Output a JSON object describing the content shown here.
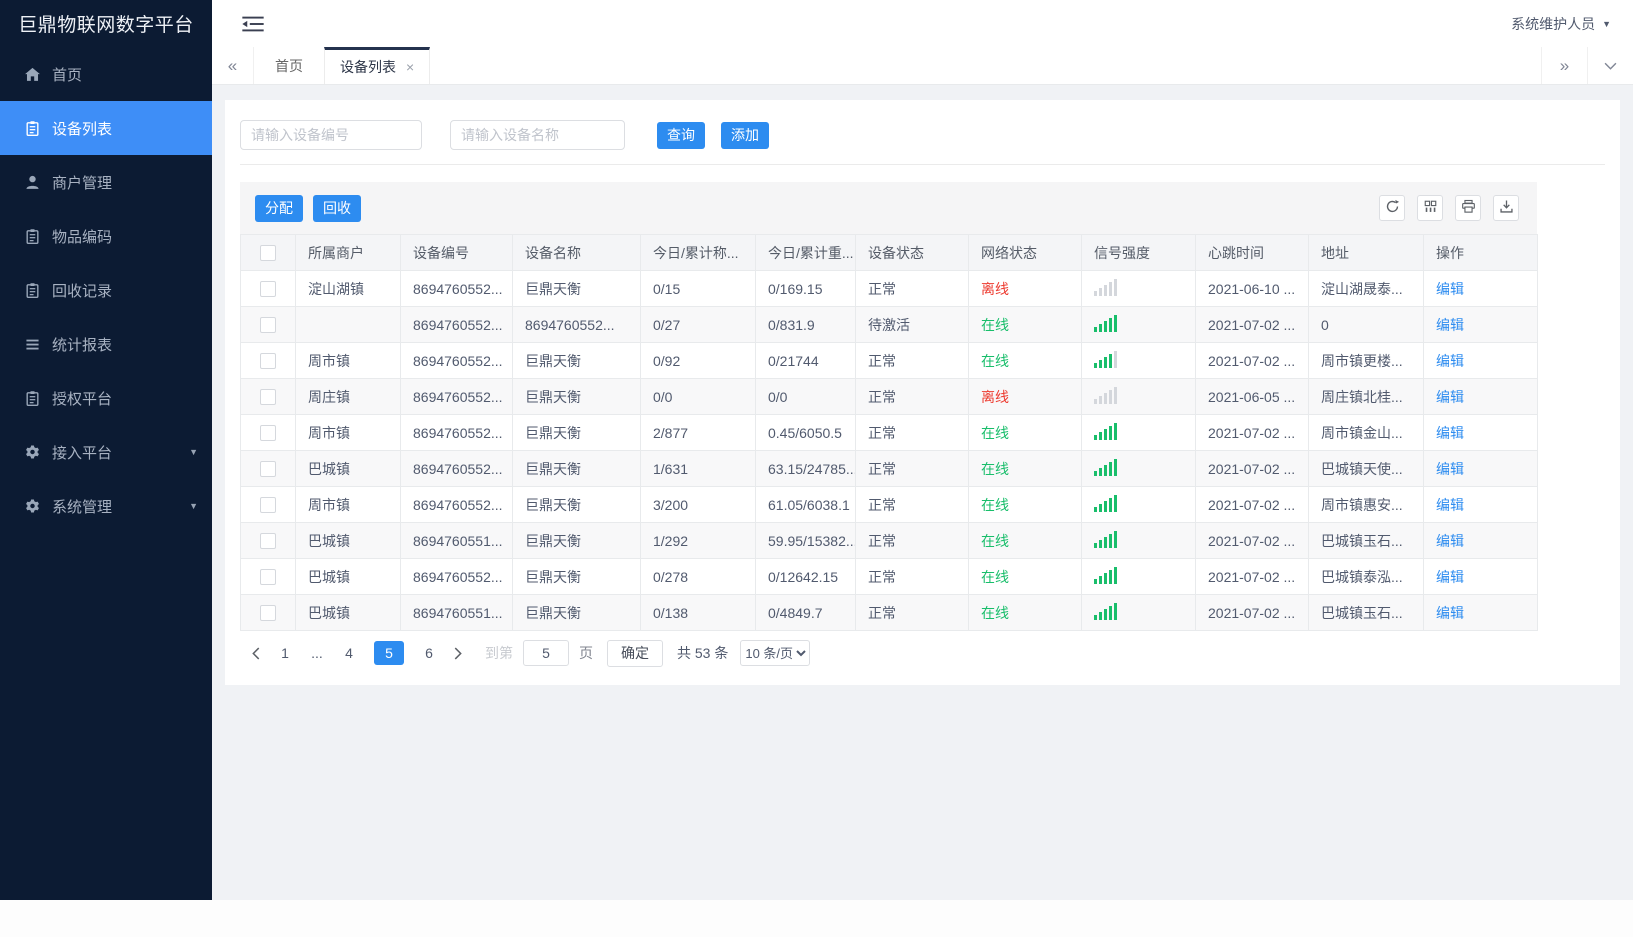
{
  "app": {
    "title": "巨鼎物联网数字平台"
  },
  "colors": {
    "primary": "#2d8cf0",
    "sidebar_bg": "#0c1b33",
    "sidebar_active": "#3e8ef7",
    "online_green": "#19be6b",
    "offline_red": "#ed3b30"
  },
  "sidebar": {
    "items": [
      {
        "key": "home",
        "label": "首页",
        "icon": "home-icon",
        "active": false,
        "expandable": false
      },
      {
        "key": "device-list",
        "label": "设备列表",
        "icon": "list-icon",
        "active": true,
        "expandable": false
      },
      {
        "key": "merchant-management",
        "label": "商户管理",
        "icon": "user-icon",
        "active": false,
        "expandable": false
      },
      {
        "key": "item-code",
        "label": "物品编码",
        "icon": "clipboard-icon",
        "active": false,
        "expandable": false
      },
      {
        "key": "recycle-records",
        "label": "回收记录",
        "icon": "clipboard-icon",
        "active": false,
        "expandable": false
      },
      {
        "key": "statistics-report",
        "label": "统计报表",
        "icon": "report-icon",
        "active": false,
        "expandable": false
      },
      {
        "key": "authorization-platform",
        "label": "授权平台",
        "icon": "clipboard-icon",
        "active": false,
        "expandable": false
      },
      {
        "key": "access-platform",
        "label": "接入平台",
        "icon": "gear-icon",
        "active": false,
        "expandable": true
      },
      {
        "key": "system-management",
        "label": "系统管理",
        "icon": "gear-icon",
        "active": false,
        "expandable": true
      }
    ]
  },
  "topbar": {
    "user_label": "系统维护人员"
  },
  "tabbar": {
    "tabs": [
      {
        "key": "home",
        "label": "首页",
        "active": false,
        "closable": false
      },
      {
        "key": "device-list",
        "label": "设备列表",
        "active": true,
        "closable": true
      }
    ]
  },
  "filters": {
    "device_no_placeholder": "请输入设备编号",
    "device_name_placeholder": "请输入设备名称",
    "search_label": "查询",
    "add_label": "添加"
  },
  "toolbar": {
    "assign_label": "分配",
    "recycle_label": "回收",
    "icons": [
      "refresh-icon",
      "columns-icon",
      "print-icon",
      "export-icon"
    ]
  },
  "table": {
    "columns": [
      "所属商户",
      "设备编号",
      "设备名称",
      "今日/累计称...",
      "今日/累计重...",
      "设备状态",
      "网络状态",
      "信号强度",
      "心跳时间",
      "地址",
      "操作"
    ],
    "action_label": "编辑",
    "rows": [
      {
        "merchant": "淀山湖镇",
        "device_no": "8694760552...",
        "device_name": "巨鼎天衡",
        "today_count": "0/15",
        "today_weight": "0/169.15",
        "device_status": "正常",
        "network_status": "离线",
        "online": false,
        "signal": 0,
        "heartbeat": "2021-06-10 ...",
        "address": "淀山湖晟泰..."
      },
      {
        "merchant": "",
        "device_no": "8694760552...",
        "device_name": "8694760552...",
        "today_count": "0/27",
        "today_weight": "0/831.9",
        "device_status": "待激活",
        "network_status": "在线",
        "online": true,
        "signal": 5,
        "heartbeat": "2021-07-02 ...",
        "address": "0"
      },
      {
        "merchant": "周市镇",
        "device_no": "8694760552...",
        "device_name": "巨鼎天衡",
        "today_count": "0/92",
        "today_weight": "0/21744",
        "device_status": "正常",
        "network_status": "在线",
        "online": true,
        "signal": 4,
        "heartbeat": "2021-07-02 ...",
        "address": "周市镇更楼..."
      },
      {
        "merchant": "周庄镇",
        "device_no": "8694760552...",
        "device_name": "巨鼎天衡",
        "today_count": "0/0",
        "today_weight": "0/0",
        "device_status": "正常",
        "network_status": "离线",
        "online": false,
        "signal": 0,
        "heartbeat": "2021-06-05 ...",
        "address": "周庄镇北桂..."
      },
      {
        "merchant": "周市镇",
        "device_no": "8694760552...",
        "device_name": "巨鼎天衡",
        "today_count": "2/877",
        "today_weight": "0.45/6050.5",
        "device_status": "正常",
        "network_status": "在线",
        "online": true,
        "signal": 5,
        "heartbeat": "2021-07-02 ...",
        "address": "周市镇金山..."
      },
      {
        "merchant": "巴城镇",
        "device_no": "8694760552...",
        "device_name": "巨鼎天衡",
        "today_count": "1/631",
        "today_weight": "63.15/24785...",
        "device_status": "正常",
        "network_status": "在线",
        "online": true,
        "signal": 5,
        "heartbeat": "2021-07-02 ...",
        "address": "巴城镇天使..."
      },
      {
        "merchant": "周市镇",
        "device_no": "8694760552...",
        "device_name": "巨鼎天衡",
        "today_count": "3/200",
        "today_weight": "61.05/6038.1",
        "device_status": "正常",
        "network_status": "在线",
        "online": true,
        "signal": 5,
        "heartbeat": "2021-07-02 ...",
        "address": "周市镇惠安..."
      },
      {
        "merchant": "巴城镇",
        "device_no": "8694760551...",
        "device_name": "巨鼎天衡",
        "today_count": "1/292",
        "today_weight": "59.95/15382...",
        "device_status": "正常",
        "network_status": "在线",
        "online": true,
        "signal": 5,
        "heartbeat": "2021-07-02 ...",
        "address": "巴城镇玉石..."
      },
      {
        "merchant": "巴城镇",
        "device_no": "8694760552...",
        "device_name": "巨鼎天衡",
        "today_count": "0/278",
        "today_weight": "0/12642.15",
        "device_status": "正常",
        "network_status": "在线",
        "online": true,
        "signal": 5,
        "heartbeat": "2021-07-02 ...",
        "address": "巴城镇泰泓..."
      },
      {
        "merchant": "巴城镇",
        "device_no": "8694760551...",
        "device_name": "巨鼎天衡",
        "today_count": "0/138",
        "today_weight": "0/4849.7",
        "device_status": "正常",
        "network_status": "在线",
        "online": true,
        "signal": 5,
        "heartbeat": "2021-07-02 ...",
        "address": "巴城镇玉石..."
      }
    ]
  },
  "pagination": {
    "pages": [
      "1",
      "...",
      "4",
      "5",
      "6"
    ],
    "active_page": "5",
    "jump_label": "到第",
    "jump_value": "5",
    "page_unit": "页",
    "confirm_label": "确定",
    "total_label": "共 53 条",
    "page_size": "10 条/页"
  }
}
